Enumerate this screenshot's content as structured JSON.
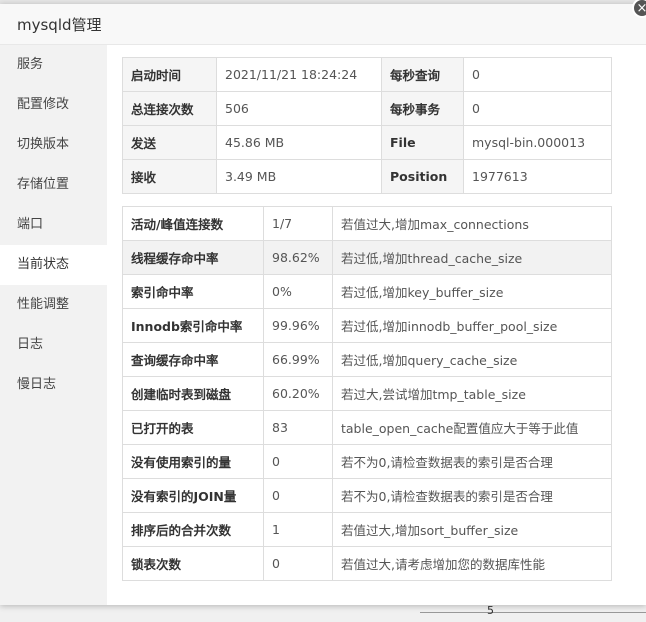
{
  "background": {
    "page_number": "5"
  },
  "modal": {
    "title": "mysqld管理",
    "close_icon": "×"
  },
  "sidebar": {
    "items": [
      {
        "label": "服务"
      },
      {
        "label": "配置修改"
      },
      {
        "label": "切换版本"
      },
      {
        "label": "存储位置"
      },
      {
        "label": "端口"
      },
      {
        "label": "当前状态",
        "active": true
      },
      {
        "label": "性能调整"
      },
      {
        "label": "日志"
      },
      {
        "label": "慢日志"
      }
    ]
  },
  "summary": {
    "rows": [
      {
        "label1": "启动时间",
        "value1": "2021/11/21 18:24:24",
        "label2": "每秒查询",
        "value2": "0"
      },
      {
        "label1": "总连接次数",
        "value1": "506",
        "label2": "每秒事务",
        "value2": "0"
      },
      {
        "label1": "发送",
        "value1": "45.86 MB",
        "label2": "File",
        "value2": "mysql-bin.000013"
      },
      {
        "label1": "接收",
        "value1": "3.49 MB",
        "label2": "Position",
        "value2": "1977613"
      }
    ]
  },
  "metrics": {
    "rows": [
      {
        "name": "活动/峰值连接数",
        "value": "1/7",
        "hint": "若值过大,增加max_connections"
      },
      {
        "name": "线程缓存命中率",
        "value": "98.62%",
        "hint": "若过低,增加thread_cache_size"
      },
      {
        "name": "索引命中率",
        "value": "0%",
        "hint": "若过低,增加key_buffer_size"
      },
      {
        "name": "Innodb索引命中率",
        "value": "99.96%",
        "hint": "若过低,增加innodb_buffer_pool_size"
      },
      {
        "name": "查询缓存命中率",
        "value": "66.99%",
        "hint": "若过低,增加query_cache_size"
      },
      {
        "name": "创建临时表到磁盘",
        "value": "60.20%",
        "hint": "若过大,尝试增加tmp_table_size"
      },
      {
        "name": "已打开的表",
        "value": "83",
        "hint": "table_open_cache配置值应大于等于此值"
      },
      {
        "name": "没有使用索引的量",
        "value": "0",
        "hint": "若不为0,请检查数据表的索引是否合理"
      },
      {
        "name": "没有索引的JOIN量",
        "value": "0",
        "hint": "若不为0,请检查数据表的索引是否合理"
      },
      {
        "name": "排序后的合并次数",
        "value": "1",
        "hint": "若值过大,增加sort_buffer_size"
      },
      {
        "name": "锁表次数",
        "value": "0",
        "hint": "若值过大,请考虑增加您的数据库性能"
      }
    ]
  }
}
